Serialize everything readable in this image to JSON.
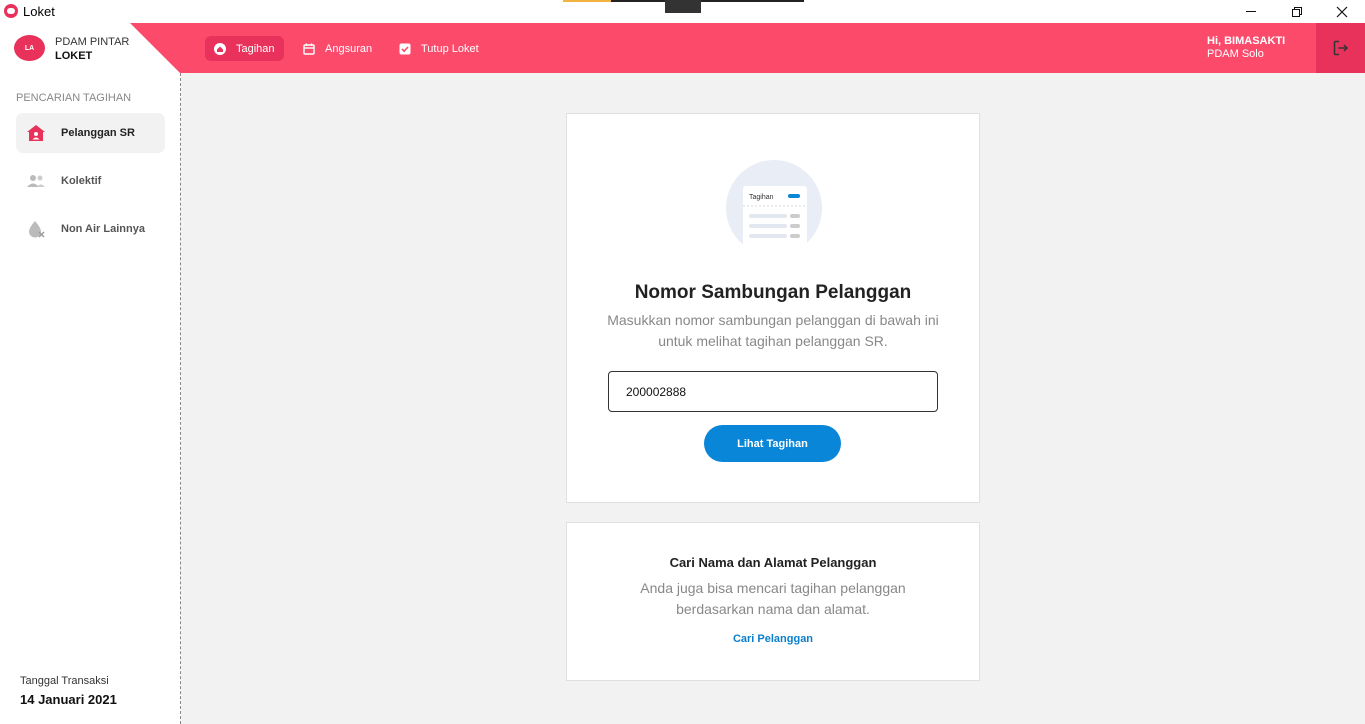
{
  "window": {
    "title": "Loket"
  },
  "brand": {
    "line1": "PDAM PINTAR",
    "line2": "LOKET",
    "logo_text": "LA"
  },
  "nav": {
    "items": [
      {
        "label": "Tagihan",
        "icon": "home-icon"
      },
      {
        "label": "Angsuran",
        "icon": "calendar-icon"
      },
      {
        "label": "Tutup Loket",
        "icon": "checkbox-icon"
      }
    ]
  },
  "user": {
    "greeting": "Hi, BIMASAKTI",
    "org": "PDAM Solo"
  },
  "sidebar": {
    "section_title": "PENCARIAN TAGIHAN",
    "items": [
      {
        "label": "Pelanggan SR",
        "icon": "house-user-icon"
      },
      {
        "label": "Kolektif",
        "icon": "group-icon"
      },
      {
        "label": "Non Air Lainnya",
        "icon": "water-drop-off-icon"
      }
    ],
    "date_label": "Tanggal Transaksi",
    "date_value": "14 Januari 2021"
  },
  "main": {
    "illustration_label": "Tagihan",
    "title": "Nomor Sambungan Pelanggan",
    "desc_line1": "Masukkan nomor sambungan pelanggan di bawah ini",
    "desc_line2": "untuk melihat tagihan pelanggan SR.",
    "input_value": "200002888",
    "button_label": "Lihat Tagihan"
  },
  "search_card": {
    "title": "Cari Nama dan Alamat Pelanggan",
    "desc_line1": "Anda juga bisa mencari tagihan pelanggan",
    "desc_line2": "berdasarkan nama dan alamat.",
    "link_label": "Cari Pelanggan"
  },
  "colors": {
    "accent": "#fc4a6b",
    "accent_dark": "#e8325c",
    "primary": "#0a86d8"
  }
}
